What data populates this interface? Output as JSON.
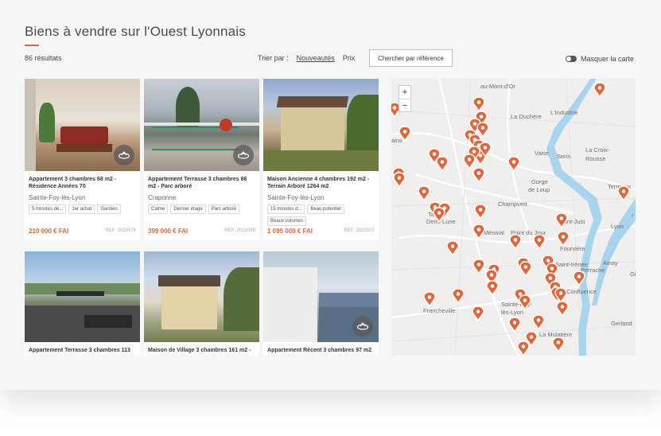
{
  "page": {
    "title": "Biens à vendre sur l'Ouest Lyonnais",
    "results": "86 résultats",
    "sort_label": "Trier par :",
    "sort_options": [
      "Nouveautés",
      "Prix"
    ],
    "ref_button": "Chercher par référence",
    "map_toggle": "Masquer la carte"
  },
  "colors": {
    "accent": "#e0663a",
    "river": "#a9d4ee"
  },
  "listings": [
    {
      "title": "Appartement 3 chambres 68 m2 - Résidence Années 70",
      "city": "Sainte-Foy-lès-Lyon",
      "tags": [
        "5 minutes de...",
        "1er achat",
        "Gardien"
      ],
      "price": "210 000 € FAI",
      "ref": "REF: 2020976",
      "has_360": true
    },
    {
      "title": "Appartement Terrasse 3 chambres 86 m2 - Parc arboré",
      "city": "Craponne",
      "tags": [
        "Calme",
        "Dernier étage",
        "Parc arboré"
      ],
      "price": "399 000 € FAI",
      "ref": "REF: 2021089",
      "has_360": true
    },
    {
      "title": "Maison Ancienne 4 chambres 192 m2 - Terrain Arboré 1264 m2",
      "city": "Sainte-Foy-lès-Lyon",
      "tags": [
        "15 minutes d...",
        "Beau potentiel",
        "Beaux volumes"
      ],
      "price": "1 095 000 € FAI",
      "ref": "REF: 2020507",
      "has_360": false
    },
    {
      "title": "Appartement Terrasse 3 chambres 113",
      "has_360": false
    },
    {
      "title": "Maison de Village 3 chambres 161 m2 -",
      "has_360": false
    },
    {
      "title": "Appartement Récent 3 chambres 97 m2",
      "has_360": true
    }
  ],
  "map": {
    "zoom_in": "+",
    "zoom_out": "−",
    "place_labels": [
      {
        "name": "au-Mont-d'Or"
      },
      {
        "name": "L'Industrie"
      },
      {
        "name": "La Duchère"
      },
      {
        "name": "Vaise"
      },
      {
        "name": "Serin"
      },
      {
        "name": "La Croix-"
      },
      {
        "name": "Rousse"
      },
      {
        "name": "Gorge"
      },
      {
        "name": "de Loup"
      },
      {
        "name": "Terreaux"
      },
      {
        "name": "Champvert"
      },
      {
        "name": "Tassin-"
      },
      {
        "name": "Demi-Lune"
      },
      {
        "name": "Ménival"
      },
      {
        "name": "Point du Jour"
      },
      {
        "name": "Saint-Just"
      },
      {
        "name": "Lyon"
      },
      {
        "name": "Fourvière"
      },
      {
        "name": "Saint-Irénée"
      },
      {
        "name": "Ainay"
      },
      {
        "name": "Perrache"
      },
      {
        "name": "Confluence"
      },
      {
        "name": "Francheville"
      },
      {
        "name": "Sainte-Foy-"
      },
      {
        "name": "lès-Lyon"
      },
      {
        "name": "La Mulatière"
      },
      {
        "name": "Gerland"
      },
      {
        "name": "ains"
      },
      {
        "name": "r"
      },
      {
        "name": "Gi"
      }
    ]
  }
}
